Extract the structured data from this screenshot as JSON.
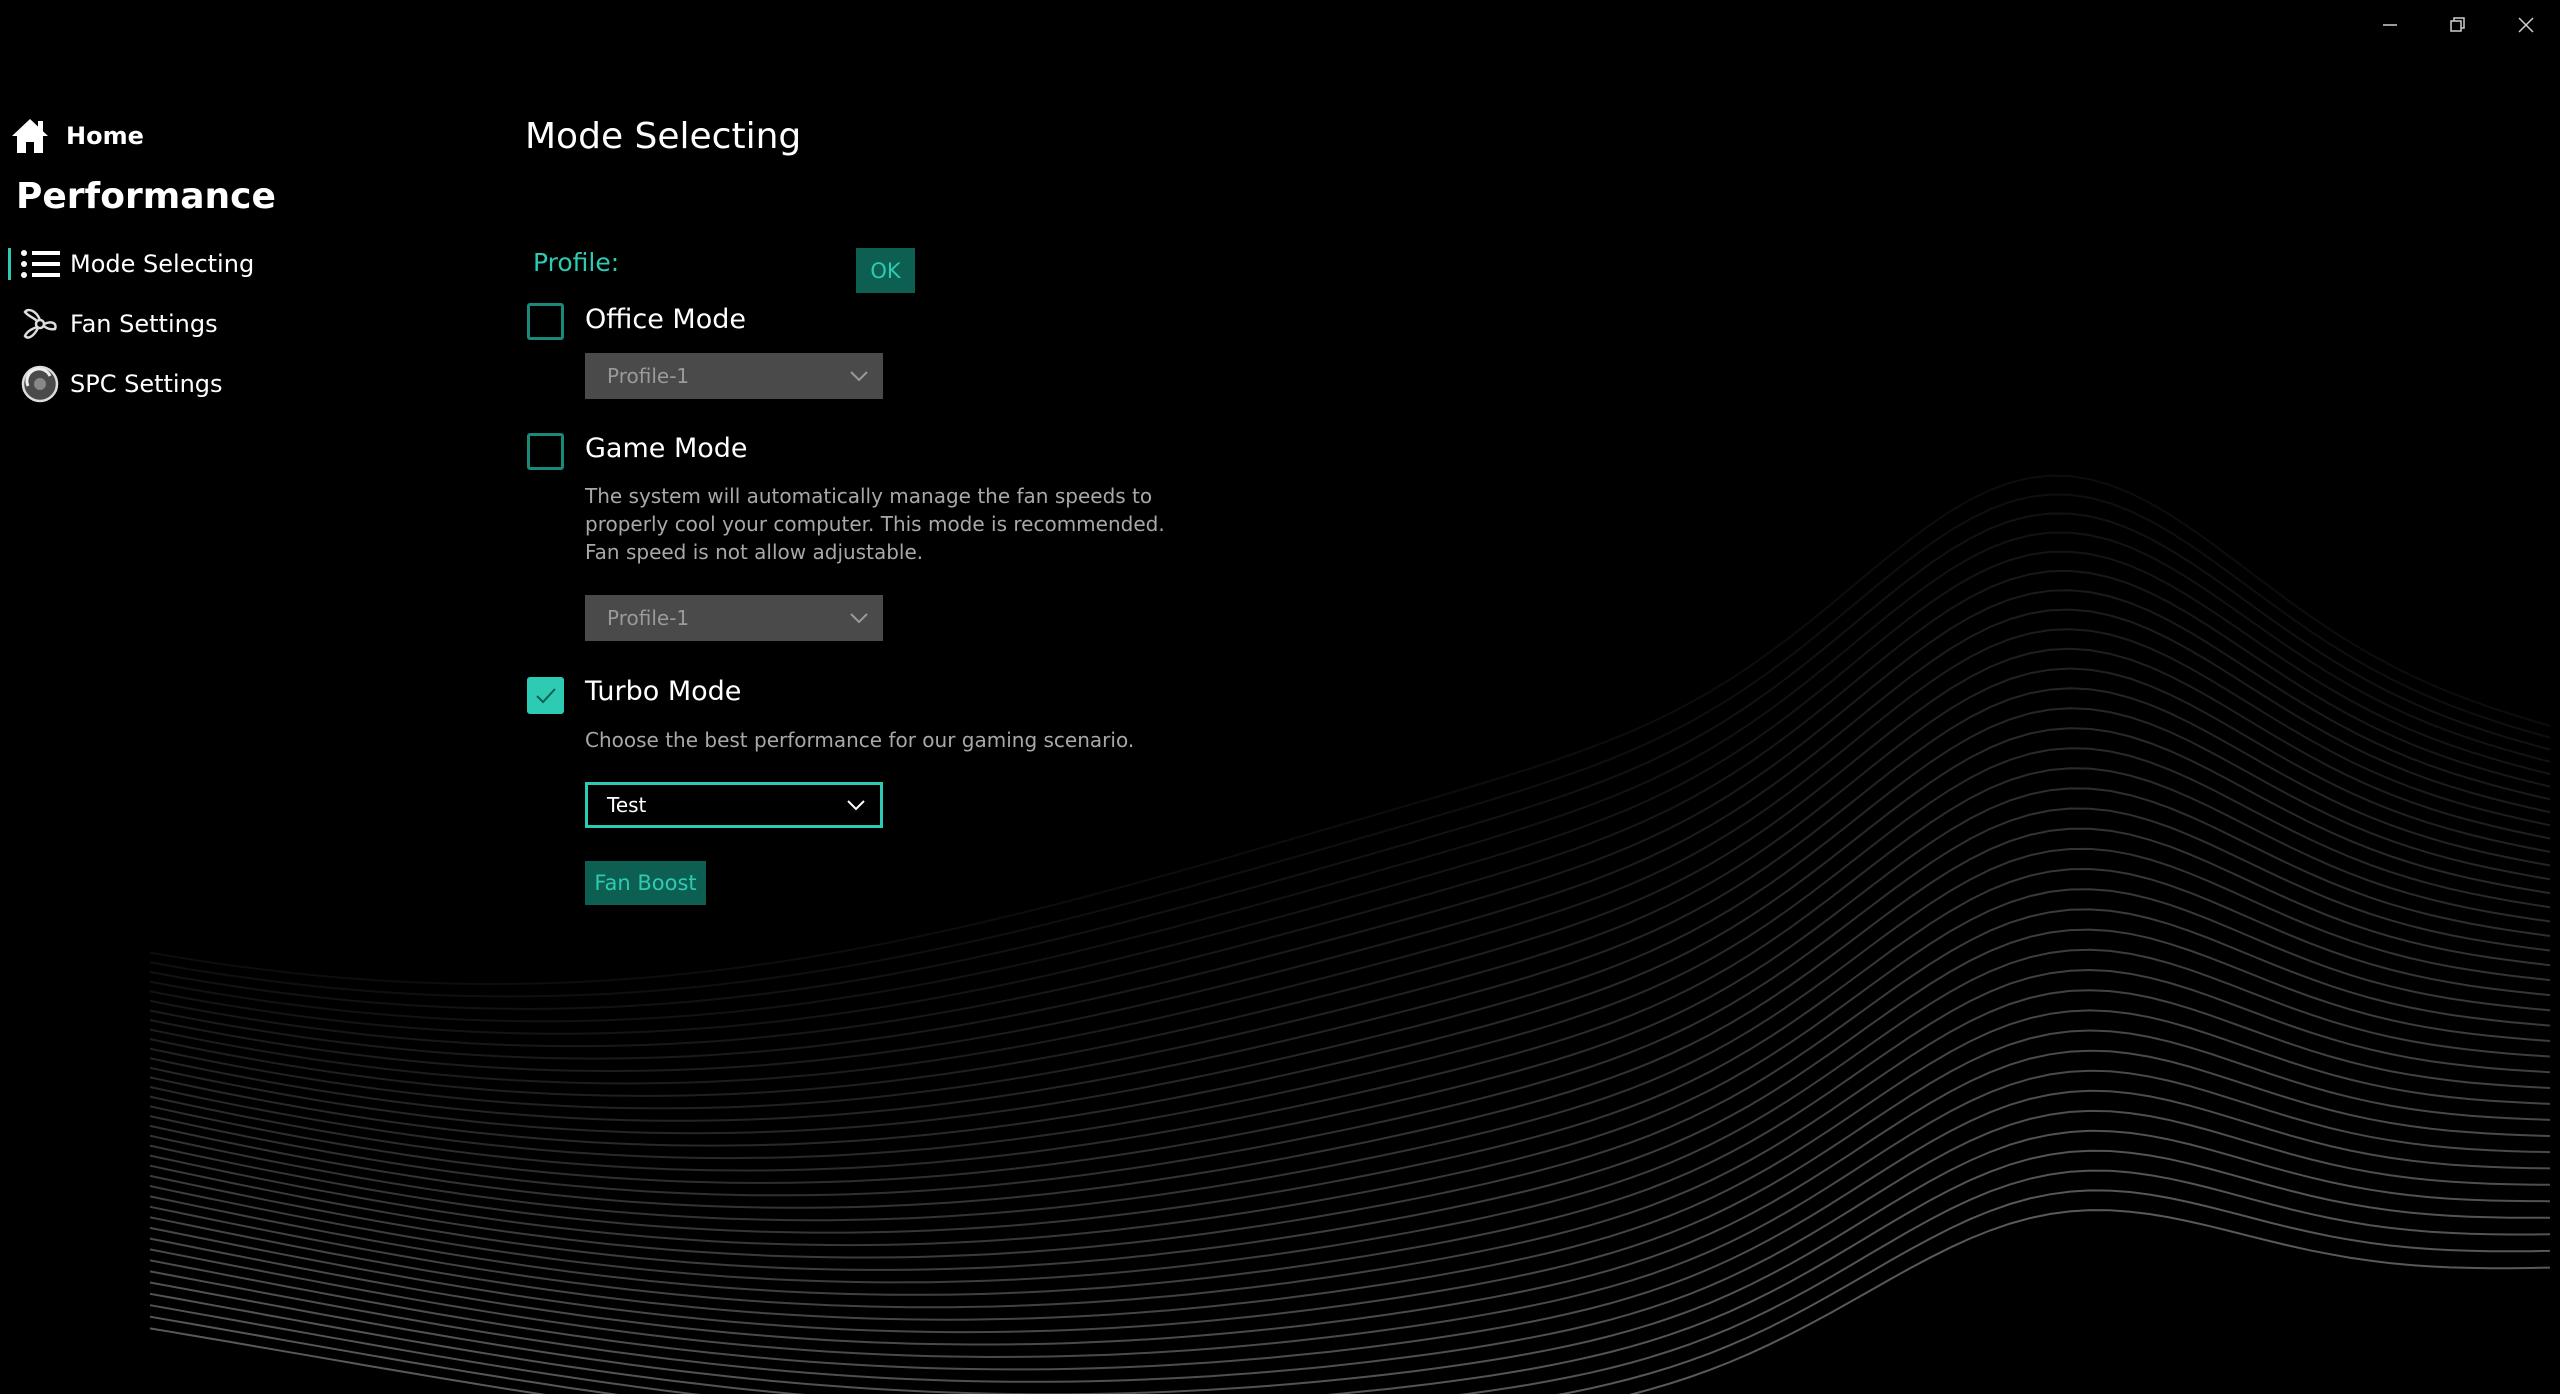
{
  "window": {
    "minimize_icon": "minimize-icon",
    "restore_icon": "restore-icon",
    "close_icon": "close-icon"
  },
  "sidebar": {
    "home_label": "Home",
    "section_title": "Performance",
    "items": [
      {
        "label": "Mode Selecting",
        "icon": "list-icon",
        "active": true
      },
      {
        "label": "Fan Settings",
        "icon": "fan-icon",
        "active": false
      },
      {
        "label": "SPC Settings",
        "icon": "spc-icon",
        "active": false
      }
    ]
  },
  "main": {
    "title": "Mode Selecting",
    "profile_label": "Profile:",
    "ok_label": "OK",
    "modes": [
      {
        "label": "Office Mode",
        "checked": false,
        "dropdown_value": "Profile-1"
      },
      {
        "label": "Game Mode",
        "checked": false,
        "description": "The system will automatically manage the fan speeds to properly cool your computer.  This mode is recommended. Fan speed is not allow adjustable.",
        "dropdown_value": "Profile-1"
      },
      {
        "label": "Turbo Mode",
        "checked": true,
        "description": "Choose the best performance for our gaming scenario.",
        "dropdown_value": "Test"
      }
    ],
    "fan_boost_label": "Fan Boost"
  },
  "colors": {
    "accent": "#2dcbb3",
    "button_bg": "#0d5f52",
    "background": "#000000"
  }
}
